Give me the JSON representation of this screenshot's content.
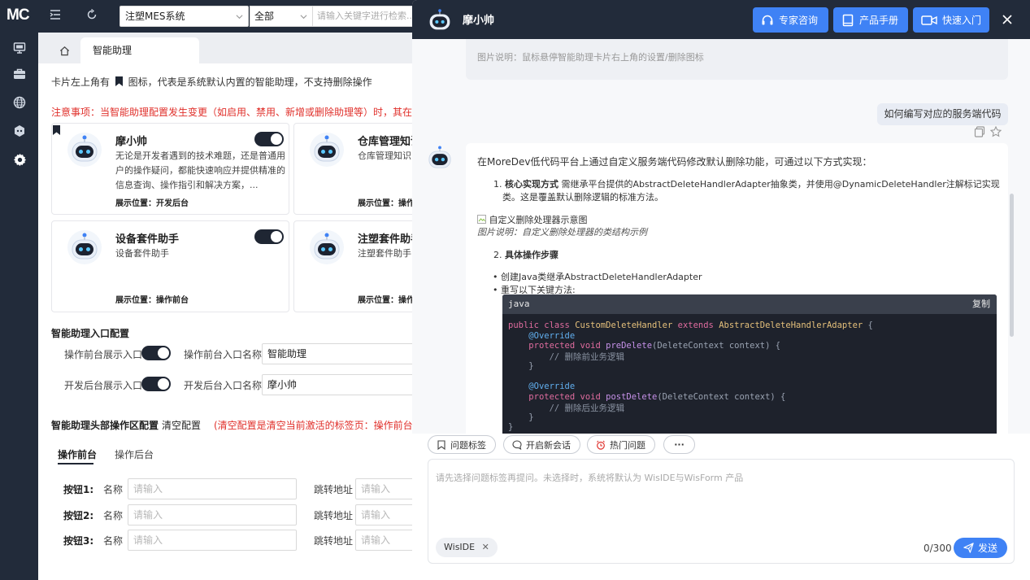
{
  "rail": {
    "logo": "MC"
  },
  "topbar": {
    "system_select": "注塑MES系统",
    "scope_select": "全部",
    "search_placeholder": "请输入关键字进行检索..."
  },
  "tabs": {
    "active": "智能助理"
  },
  "notice": {
    "prefix": "卡片左上角有",
    "suffix": "图标，代表是系统默认内置的智能助理，不支持删除操作",
    "warning": "注意事项：当智能助理配置发生变更（如启用、禁用、新增或删除助理等）时，其在前台和"
  },
  "cards": [
    {
      "title": "摩小帅",
      "desc": "无论是开发者遇到的技术难题，还是普通用户的操作疑问，都能快速响应并提供精准的信息查询、操作指引和解决方案，...",
      "position": "展示位置：开发后台",
      "enabled": true,
      "builtin": true
    },
    {
      "title": "仓库管理知识",
      "desc": "仓库管理知识",
      "position": "展示位置：操作",
      "enabled": true,
      "builtin": false
    },
    {
      "title": "设备套件助手",
      "desc": "设备套件助手",
      "position": "展示位置：操作前台",
      "enabled": true,
      "builtin": false
    },
    {
      "title": "注塑套件助手",
      "desc": "注塑套件助手",
      "position": "展示位置：操作",
      "enabled": true,
      "builtin": false
    }
  ],
  "entry_config": {
    "title": "智能助理入口配置",
    "front_show_label": "操作前台展示入口",
    "front_name_label": "操作前台入口名称",
    "front_name_value": "智能助理",
    "back_show_label": "开发后台展示入口",
    "back_name_label": "开发后台入口名称",
    "back_name_value": "摩小帅"
  },
  "header_config": {
    "title": "智能助理头部操作区配置",
    "clear_label": "清空配置",
    "clear_hint": "(清空配置是清空当前激活的标签页：操作前台或开",
    "tabs": [
      "操作前台",
      "操作后台"
    ],
    "rows": [
      {
        "label": "按钮1:",
        "name_label": "名称",
        "name_placeholder": "请输入",
        "url_label": "跳转地址",
        "url_placeholder": "请输入"
      },
      {
        "label": "按钮2:",
        "name_label": "名称",
        "name_placeholder": "请输入",
        "url_label": "跳转地址",
        "url_placeholder": "请输入"
      },
      {
        "label": "按钮3:",
        "name_label": "名称",
        "name_placeholder": "请输入",
        "url_label": "跳转地址",
        "url_placeholder": "请输入"
      }
    ]
  },
  "chat": {
    "title": "摩小帅",
    "buttons": [
      "专家咨询",
      "产品手册",
      "快速入门"
    ],
    "prev_caption": "图片说明：鼠标悬停智能助理卡片右上角的设置/删除图标",
    "user_question": "如何编写对应的服务端代码",
    "answer": {
      "intro": "在MoreDev低代码平台上通过自定义服务端代码修改默认删除功能，可通过以下方式实现：",
      "item1_bold": "核心实现方式",
      "item1_text": "需继承平台提供的AbstractDeleteHandlerAdapter抽象类，并使用@DynamicDeleteHandler注解标记实现",
      "item1_text2": "类。这是覆盖默认删除逻辑的标准方法。",
      "image_alt": "自定义删除处理器示意图",
      "image_caption": "图片说明：自定义删除处理器的类结构示例",
      "item2_bold": "具体操作步骤",
      "bullet1": "创建Java类继承AbstractDeleteHandlerAdapter",
      "bullet2": "重写以下关键方法:",
      "code_lang": "java",
      "copy_label": "复制"
    },
    "quick_actions": [
      "问题标签",
      "开启新会话",
      "热门问题",
      "···"
    ],
    "composer_placeholder": "请先选择问题标签再提问。未选择时，系统将默认为 WisIDE与WisForm 产品",
    "chip": "WisIDE",
    "counter": "0/300",
    "send_label": "发送"
  }
}
